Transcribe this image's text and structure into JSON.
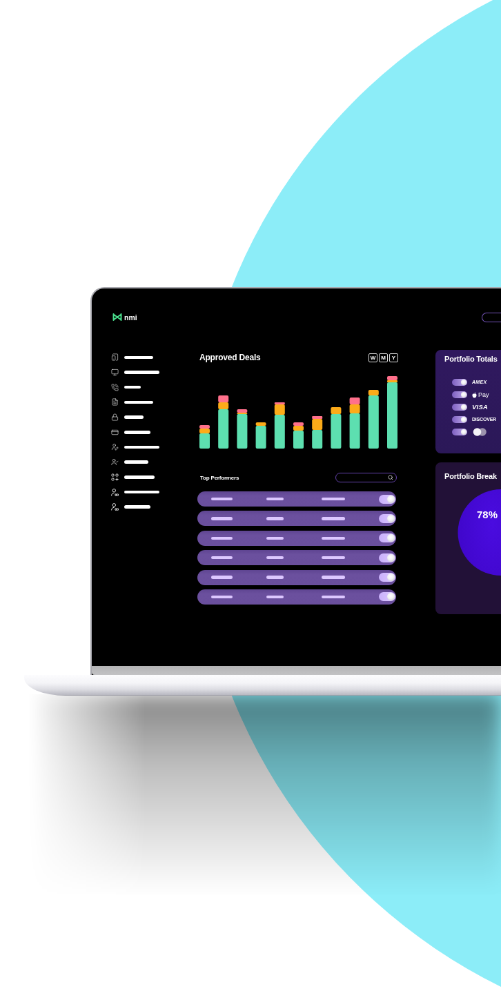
{
  "logo": {
    "text": "nmi"
  },
  "sidebar": {
    "items": [
      {
        "kind": "devices"
      },
      {
        "kind": "monitor"
      },
      {
        "kind": "phone"
      },
      {
        "kind": "document"
      },
      {
        "kind": "lock"
      },
      {
        "kind": "card"
      },
      {
        "kind": "useredit"
      },
      {
        "kind": "usercheck"
      },
      {
        "kind": "apps"
      },
      {
        "kind": "userlink"
      },
      {
        "kind": "userlink"
      }
    ]
  },
  "approved_deals": {
    "title": "Approved Deals",
    "periods": [
      {
        "label": "W",
        "selected": false
      },
      {
        "label": "M",
        "selected": false
      },
      {
        "label": "Y",
        "selected": false
      }
    ]
  },
  "top_performers": {
    "title": "Top Performers",
    "rows": [
      {
        "on": true
      },
      {
        "on": true
      },
      {
        "on": true
      },
      {
        "on": true
      },
      {
        "on": true
      },
      {
        "on": true
      }
    ]
  },
  "portfolio_totals": {
    "title": "Portfolio Totals",
    "methods": [
      {
        "kind": "amex",
        "label": "AMEX",
        "on": true
      },
      {
        "kind": "applepay",
        "label": "Pay",
        "on": true
      },
      {
        "kind": "visa",
        "label": "VISA",
        "on": true
      },
      {
        "kind": "discover",
        "label": "DISCOVER",
        "on": true
      },
      {
        "kind": "circles",
        "on": true
      }
    ]
  },
  "portfolio_breakdown": {
    "title": "Portfolio Break",
    "slice_label": "78%"
  }
}
